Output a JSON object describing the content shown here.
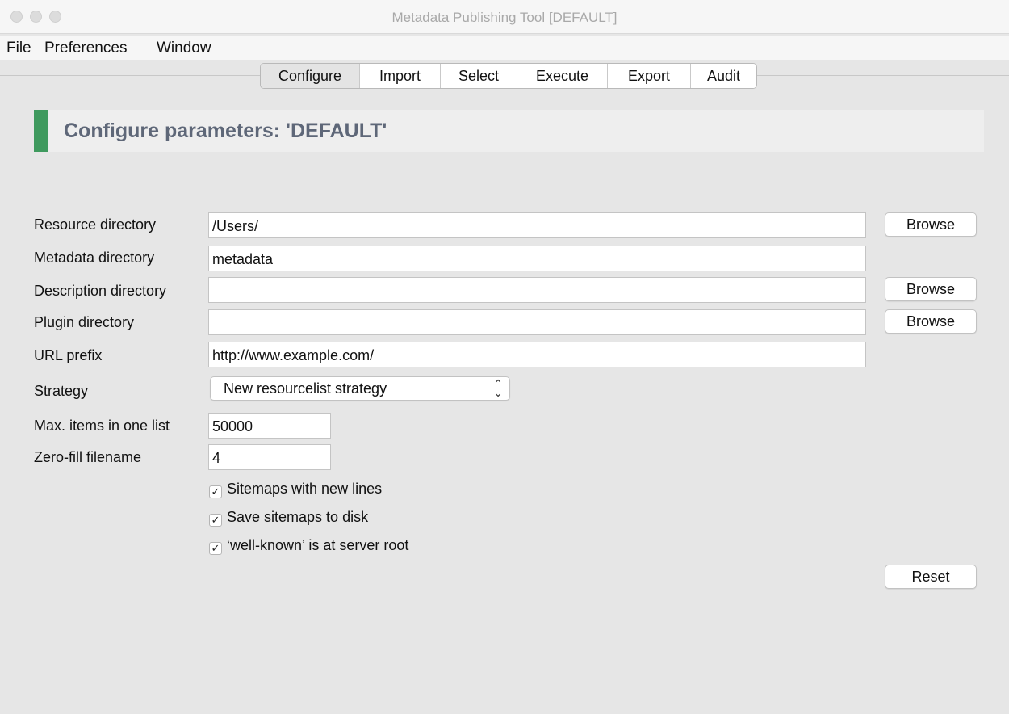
{
  "window": {
    "title": "Metadata Publishing Tool [DEFAULT]",
    "controls": [
      "close",
      "minimize",
      "zoom"
    ]
  },
  "menu": {
    "items": [
      "File",
      "Preferences",
      "Window"
    ]
  },
  "tabs": {
    "items": [
      "Configure",
      "Import",
      "Select",
      "Execute",
      "Export",
      "Audit"
    ],
    "active": "Configure"
  },
  "header": {
    "title": "Configure parameters: 'DEFAULT'",
    "accent_color": "#3f9a5e"
  },
  "form": {
    "resource_directory": {
      "label": "Resource directory",
      "value": "/Users/",
      "button": "Browse"
    },
    "metadata_directory": {
      "label": "Metadata directory",
      "value": "metadata"
    },
    "description_directory": {
      "label": "Description directory",
      "value": "",
      "button": "Browse"
    },
    "plugin_directory": {
      "label": "Plugin directory",
      "value": "",
      "button": "Browse"
    },
    "url_prefix": {
      "label": "URL prefix",
      "value": "http://www.example.com/"
    },
    "strategy": {
      "label": "Strategy",
      "value": "New resourcelist strategy"
    },
    "max_items": {
      "label": "Max. items in one list",
      "value": "50000"
    },
    "zero_fill": {
      "label": "Zero-fill filename",
      "value": "4"
    },
    "checkboxes": [
      {
        "label": "Sitemaps with new lines",
        "checked": true
      },
      {
        "label": "Save sitemaps to disk",
        "checked": true
      },
      {
        "label": "‘well-known’ is at server root",
        "checked": true
      }
    ],
    "reset_button": "Reset"
  }
}
